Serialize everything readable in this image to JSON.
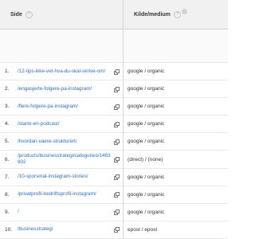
{
  "header": {
    "page_col": "Side",
    "source_col": "Kilde/medium"
  },
  "rows": [
    {
      "num": "1.",
      "page": "/12-tips-ikke-vet-hva-du-skal-skrive-om/",
      "source": "google / organic"
    },
    {
      "num": "2.",
      "page": "/engasjerte-folgere-pa-instagram/",
      "source": "google / organic"
    },
    {
      "num": "3.",
      "page": "/flere-folgere-pa-instagram/",
      "source": "google / organic"
    },
    {
      "num": "4.",
      "page": "/starte-en-podcast/",
      "source": "google / organic"
    },
    {
      "num": "5.",
      "page": "/hvordan-vaere-strukturert/",
      "source": "google / organic"
    },
    {
      "num": "6.",
      "page": "/products/businesstrategi/categories/1463902",
      "source": "(direct) / (none)"
    },
    {
      "num": "7.",
      "page": "/10-sporsmal-instagram-stories/",
      "source": "google / organic"
    },
    {
      "num": "8.",
      "page": "/privatprofil-bedriftsprofil-instagram/",
      "source": "google / organic"
    },
    {
      "num": "9.",
      "page": "/",
      "source": "google / organic"
    },
    {
      "num": "10.",
      "page": "/businesstrategi",
      "source": "epost / epost"
    }
  ]
}
